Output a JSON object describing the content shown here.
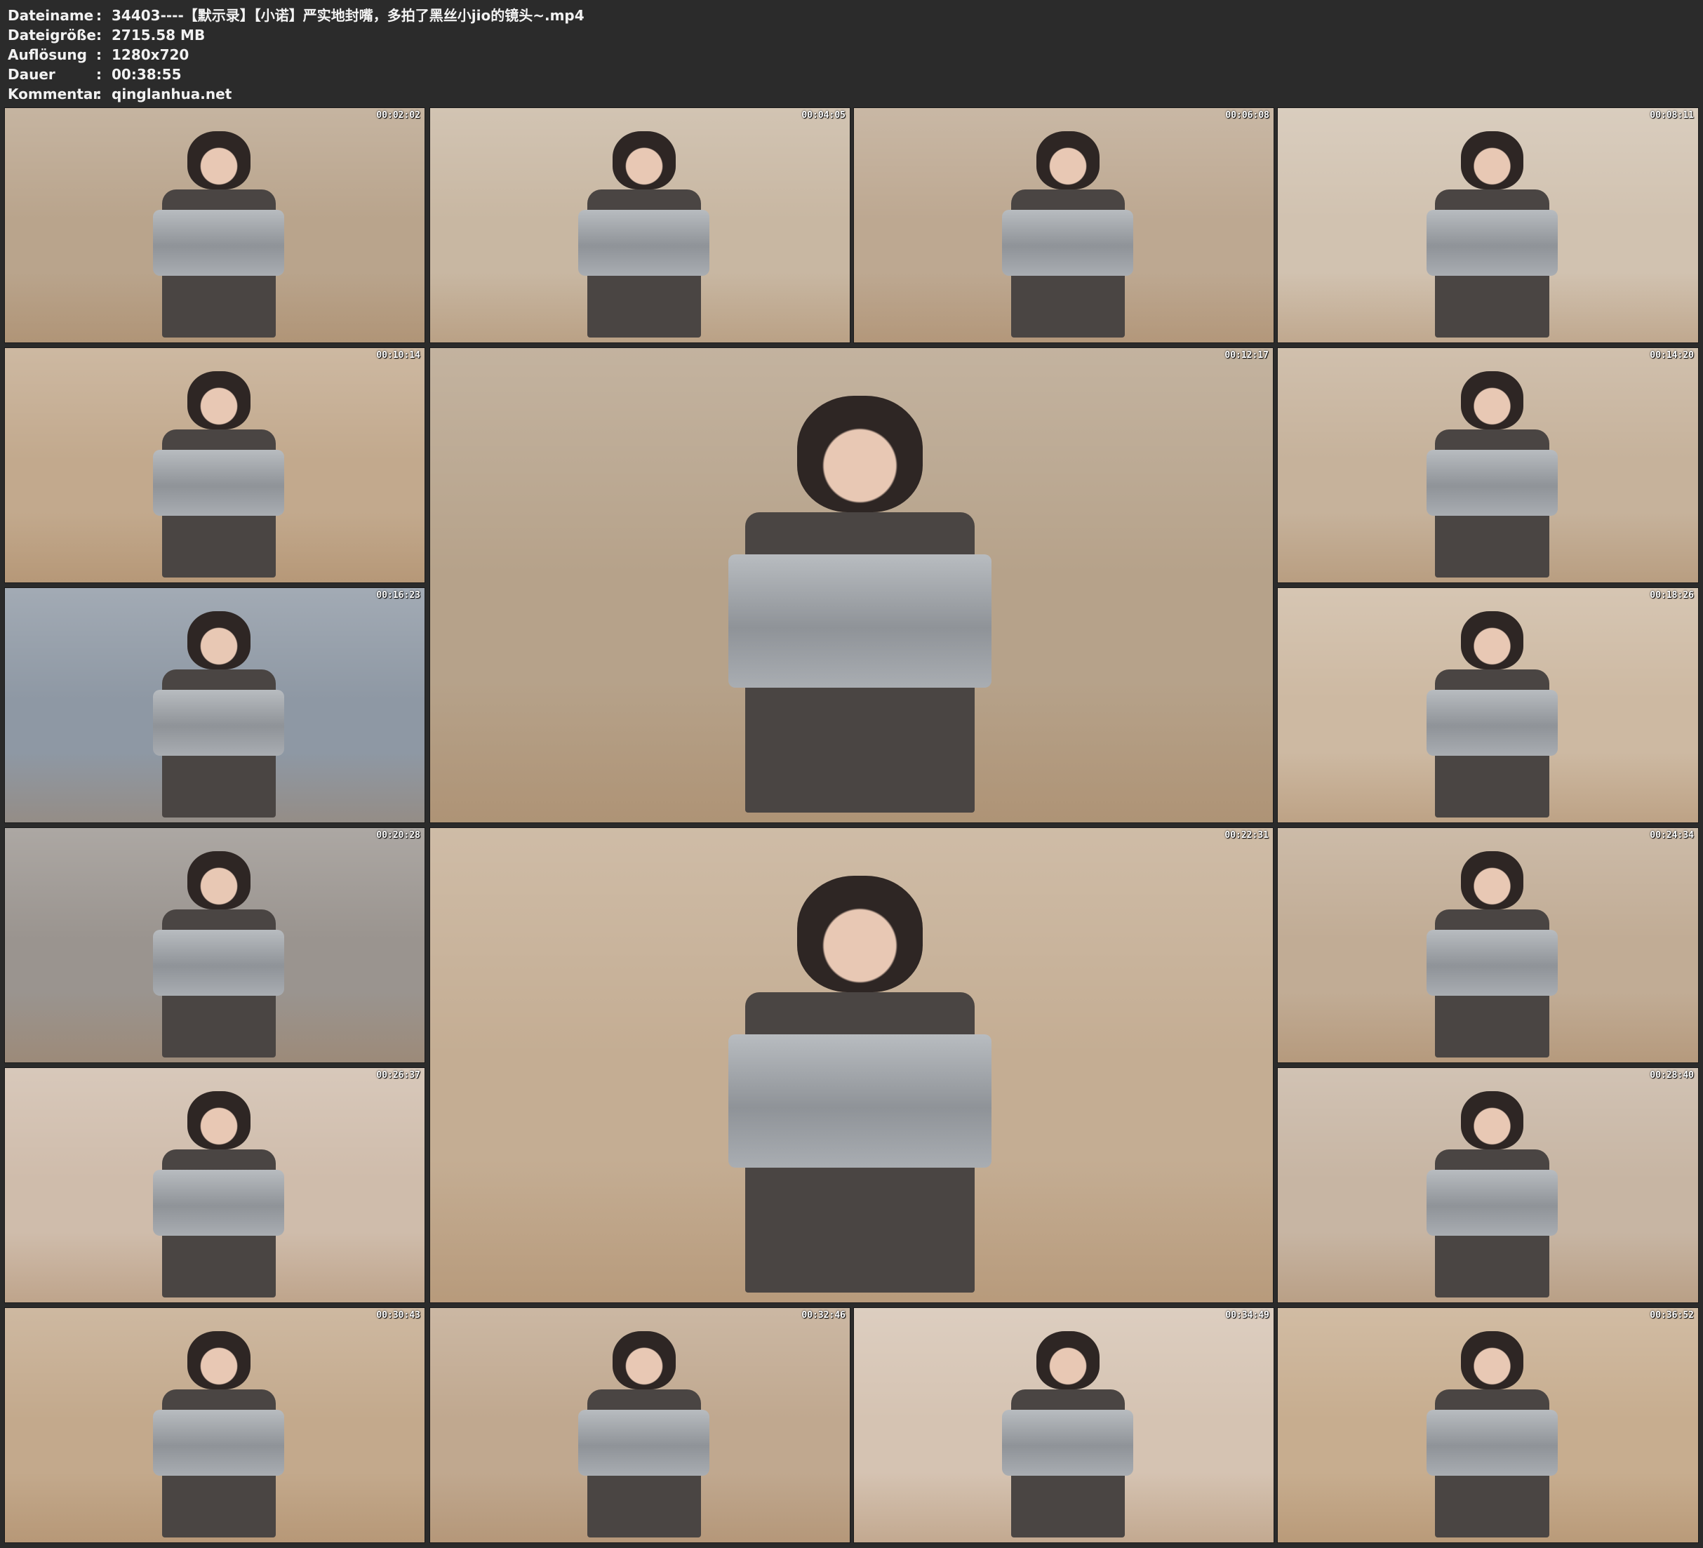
{
  "info": {
    "filename_label": "Dateiname",
    "filename": "34403----【默示录】【小诺】严实地封嘴，多拍了黑丝小jio的镜头~.mp4",
    "filesize_label": "Dateigröße",
    "filesize": "2715.58 MB",
    "resolution_label": "Auflösung",
    "resolution": "1280x720",
    "duration_label": "Dauer",
    "duration": "00:38:55",
    "comment_label": "Kommentar",
    "comment": "qinglanhua.net",
    "separator": ":"
  },
  "thumbnails": [
    {
      "time": "00:02:02",
      "tone": "#b9a48c"
    },
    {
      "time": "00:04:05",
      "tone": "#c8b7a2"
    },
    {
      "time": "00:06:08",
      "tone": "#bda891"
    },
    {
      "time": "00:08:11",
      "tone": "#d1c2b0"
    },
    {
      "time": "00:10:14",
      "tone": "#c2a98d"
    },
    {
      "time": "00:12:17",
      "tone": "#b6a28a"
    },
    {
      "time": "00:14:20",
      "tone": "#c6b29b"
    },
    {
      "time": "00:16:23",
      "tone": "#8e98a4"
    },
    {
      "time": "00:18:26",
      "tone": "#cdb9a2"
    },
    {
      "time": "00:20:28",
      "tone": "#9a948f"
    },
    {
      "time": "00:22:31",
      "tone": "#c4ad93"
    },
    {
      "time": "00:24:34",
      "tone": "#c1ac95"
    },
    {
      "time": "00:26:37",
      "tone": "#cfbcab"
    },
    {
      "time": "00:28:40",
      "tone": "#c7b5a3"
    },
    {
      "time": "00:30:43",
      "tone": "#c3a98c"
    },
    {
      "time": "00:32:46",
      "tone": "#c0a88f"
    },
    {
      "time": "00:34:49",
      "tone": "#d5c3b2"
    },
    {
      "time": "00:36:52",
      "tone": "#c7ad8f"
    }
  ]
}
